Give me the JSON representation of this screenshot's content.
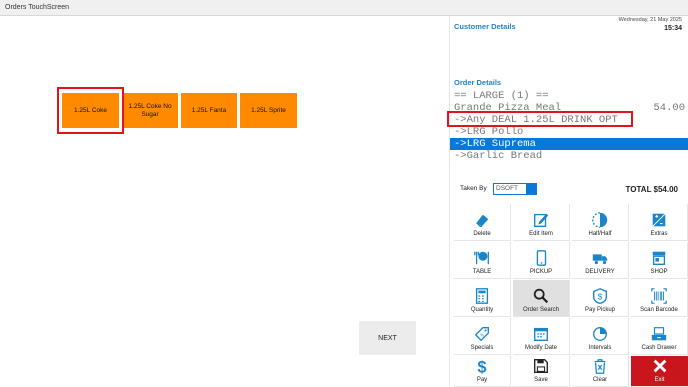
{
  "window": {
    "title": "Orders TouchScreen"
  },
  "drinks": [
    {
      "label": "1.25L Coke",
      "selected": true
    },
    {
      "label": "1.25L Coke No Sugar",
      "selected": false
    },
    {
      "label": "1.25L Fanta",
      "selected": false
    },
    {
      "label": "1.25L Sprite",
      "selected": false
    }
  ],
  "next_label": "NEXT",
  "customer": {
    "title": "Customer Details",
    "date": "Wednesday, 21 May 2025",
    "time": "15:34"
  },
  "order": {
    "title": "Order Details",
    "lines": [
      {
        "text": "== LARGE (1) ==",
        "price": ""
      },
      {
        "text": "Grande Pizza Meal",
        "price": "54.00"
      },
      {
        "text": "->Any DEAL 1.25L DRINK OPT",
        "price": ""
      },
      {
        "text": "->LRG Pollo",
        "price": ""
      },
      {
        "text": "->LRG Suprema",
        "price": ""
      },
      {
        "text": "->Garlic Bread",
        "price": ""
      }
    ],
    "selected_line": "->LRG Suprema",
    "highlighted_line": "->Any DEAL 1.25L DRINK OPT"
  },
  "taken_by": {
    "label": "Taken By",
    "value": "DSOFT"
  },
  "total": {
    "text": "TOTAL  $54.00"
  },
  "actions": [
    {
      "label": "Delete",
      "icon": "eraser-icon"
    },
    {
      "label": "Edit Item",
      "icon": "edit-icon"
    },
    {
      "label": "Half/Half",
      "icon": "half-circle-icon"
    },
    {
      "label": "Extras",
      "icon": "extras-icon"
    },
    {
      "label": "TABLE",
      "icon": "table-icon"
    },
    {
      "label": "PICKUP",
      "icon": "mobile-icon"
    },
    {
      "label": "DELIVERY",
      "icon": "truck-icon"
    },
    {
      "label": "SHOP",
      "icon": "shop-icon"
    },
    {
      "label": "Quantity",
      "icon": "calculator-icon"
    },
    {
      "label": "Order Search",
      "icon": "search-icon"
    },
    {
      "label": "Pay Pickup",
      "icon": "pay-pickup-icon"
    },
    {
      "label": "Scan Barcode",
      "icon": "barcode-icon"
    },
    {
      "label": "Specials",
      "icon": "specials-tag-icon"
    },
    {
      "label": "Modify Date",
      "icon": "calendar-icon"
    },
    {
      "label": "Intervals",
      "icon": "clock-icon"
    },
    {
      "label": "Cash Drawer",
      "icon": "cash-drawer-icon"
    },
    {
      "label": "Pay",
      "icon": "dollar-icon"
    },
    {
      "label": "Save",
      "icon": "save-icon"
    },
    {
      "label": "Clear",
      "icon": "trash-icon"
    },
    {
      "label": "Exit",
      "icon": "close-icon"
    }
  ],
  "colors": {
    "accent": "#1a86c8",
    "drink_button": "#ff8a00",
    "highlight": "#e0141c",
    "selection": "#0a78d8",
    "exit": "#c8161c"
  }
}
